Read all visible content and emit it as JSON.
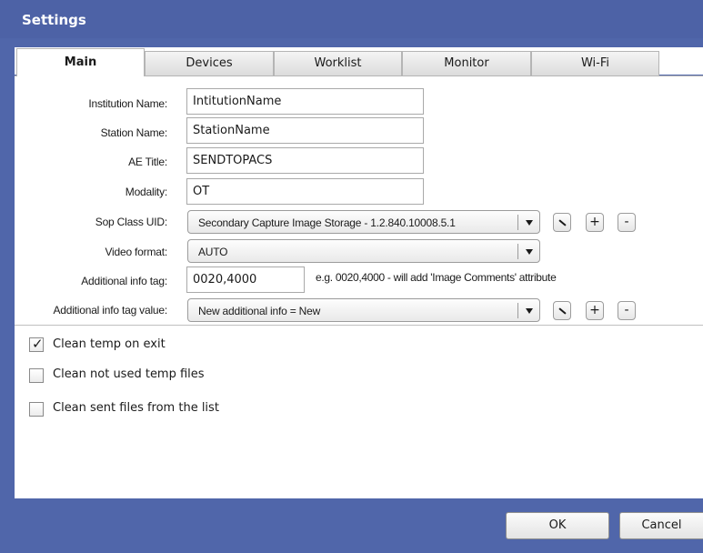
{
  "window": {
    "title": "Settings"
  },
  "tabs": [
    {
      "label": "Main",
      "active": true
    },
    {
      "label": "Devices",
      "active": false
    },
    {
      "label": "Worklist",
      "active": false
    },
    {
      "label": "Monitor",
      "active": false
    },
    {
      "label": "Wi-Fi",
      "active": false
    }
  ],
  "form": {
    "institution_name": {
      "label": "Institution Name:",
      "value": "IntitutionName"
    },
    "station_name": {
      "label": "Station Name:",
      "value": "StationName"
    },
    "ae_title": {
      "label": "AE Title:",
      "value": "SENDTOPACS"
    },
    "modality": {
      "label": "Modality:",
      "value": "OT"
    },
    "sop_class_uid": {
      "label": "Sop Class UID:",
      "value": "Secondary Capture Image Storage - 1.2.840.10008.5.1"
    },
    "video_format": {
      "label": "Video format:",
      "value": "AUTO"
    },
    "additional_info_tag": {
      "label": "Additional info tag:",
      "value": "0020,4000",
      "hint": "e.g. 0020,4000 - will add 'Image Comments' attribute"
    },
    "additional_info_tag_value": {
      "label": "Additional info tag value:",
      "value": "New additional info  = New"
    },
    "small_buttons": {
      "add": "+",
      "remove": "-"
    }
  },
  "options": [
    {
      "label": "Clean temp on exit",
      "checked": true
    },
    {
      "label": "Clean not used temp files",
      "checked": false
    },
    {
      "label": "Clean sent files from the list",
      "checked": false
    }
  ],
  "footer": {
    "ok_label": "OK",
    "cancel_label": "Cancel"
  },
  "colors": {
    "title_bar": "#4d62a6",
    "panel": "#ffffff"
  },
  "icons": {
    "edit": "pencil-icon",
    "dropdown": "chevron-down-icon",
    "check": "checkmark-icon"
  }
}
